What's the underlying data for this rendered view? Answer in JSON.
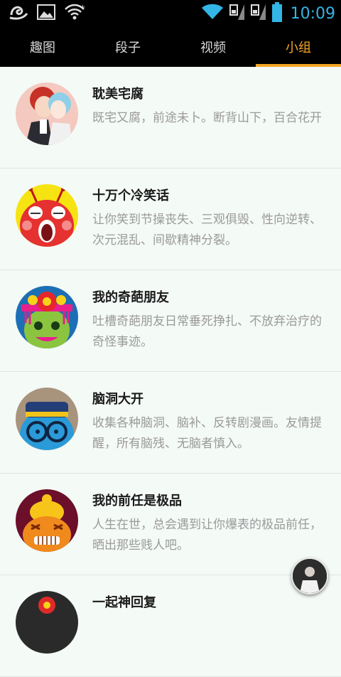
{
  "status_bar": {
    "time": "10:09",
    "icons": [
      "uc-browser-icon",
      "image-icon",
      "wifi-plus-icon",
      "wifi-icon",
      "signal-icon",
      "signal-icon",
      "battery-icon"
    ]
  },
  "tabs": [
    {
      "label": "趣图",
      "active": false
    },
    {
      "label": "段子",
      "active": false
    },
    {
      "label": "视频",
      "active": false
    },
    {
      "label": "小组",
      "active": true
    }
  ],
  "groups": [
    {
      "name": "耽美宅腐",
      "desc": "既宅又腐，前途未卜。断背山下，百合花开",
      "avatar": "anime-couple-avatar"
    },
    {
      "name": "十万个冷笑话",
      "desc": "让你笑到节操丧失、三观俱毁、性向逆转、次元混乱、间歇精神分裂。",
      "avatar": "red-monster-avatar"
    },
    {
      "name": "我的奇葩朋友",
      "desc": "吐槽奇葩朋友日常垂死挣扎、不放弃治疗的奇怪事迹。",
      "avatar": "green-face-avatar"
    },
    {
      "name": "脑洞大开",
      "desc": "收集各种脑洞、脑补、反转剧漫画。友情提醒，所有脑残、无脑者慎入。",
      "avatar": "blue-glasses-avatar"
    },
    {
      "name": "我的前任是极品",
      "desc": "人生在世，总会遇到让你爆表的极品前任，晒出那些贱人吧。",
      "avatar": "orange-face-avatar"
    },
    {
      "name": "一起神回复",
      "desc": "",
      "avatar": "dark-avatar"
    }
  ],
  "colors": {
    "accent": "#f5a623",
    "clock": "#33b5e5",
    "background": "#f4faf6"
  }
}
